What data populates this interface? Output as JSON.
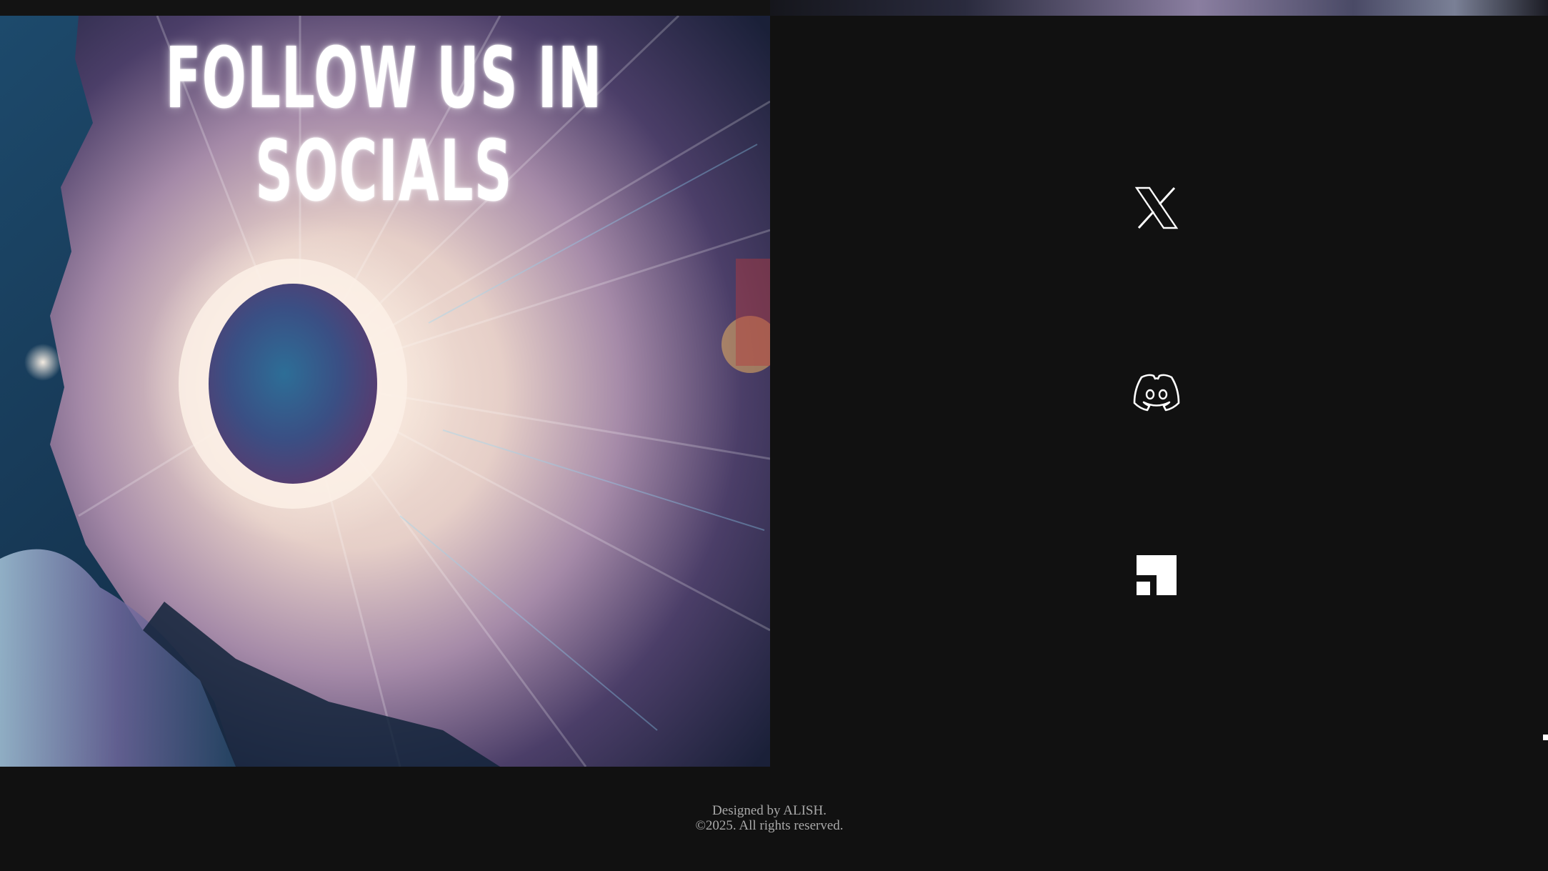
{
  "hero": {
    "title": "FOLLOW US IN SOCIALS"
  },
  "socials": {
    "items": [
      {
        "name": "x",
        "icon": "x-logo-icon"
      },
      {
        "name": "discord",
        "icon": "discord-logo-icon"
      },
      {
        "name": "blocks",
        "icon": "pixel-block-logo-icon"
      }
    ]
  },
  "footer": {
    "designed_by": "Designed by ALISH.",
    "copyright": "©2025. All rights reserved."
  },
  "colors": {
    "background": "#111111",
    "text": "#ffffff",
    "footer_text": "#a9a9a9"
  }
}
